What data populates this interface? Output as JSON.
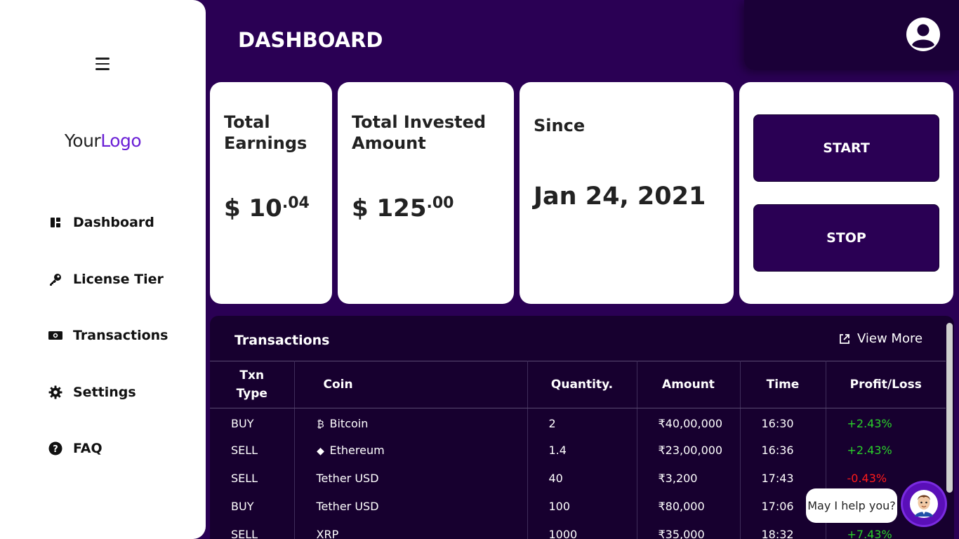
{
  "sidebar": {
    "logo_part1": "Your",
    "logo_part2": "Logo",
    "items": [
      {
        "label": "Dashboard",
        "icon": "dashboard-icon"
      },
      {
        "label": "License Tier",
        "icon": "key-icon"
      },
      {
        "label": "Transactions",
        "icon": "money-icon"
      },
      {
        "label": "Settings",
        "icon": "gear-icon"
      },
      {
        "label": "FAQ",
        "icon": "question-circle-icon"
      }
    ]
  },
  "header": {
    "title": "DASHBOARD",
    "profile_icon": "user-circle-icon"
  },
  "cards": {
    "earnings": {
      "title_line1": "Total",
      "title_line2": "Earnings",
      "currency": "$",
      "whole": "10",
      "decimal": ".04"
    },
    "invested": {
      "title_line1": "Total Invested",
      "title_line2": "Amount",
      "currency": "$",
      "whole": "125",
      "decimal": ".00"
    },
    "since": {
      "title": "Since",
      "date": "Jan 24, 2021"
    },
    "controls": {
      "start_label": "START",
      "stop_label": "STOP"
    }
  },
  "transactions": {
    "title": "Transactions",
    "view_more": "View More",
    "columns": [
      "Txn Type",
      "Coin",
      "Quantity.",
      "Amount",
      "Time",
      "Profit/Loss"
    ],
    "rows": [
      {
        "type": "BUY",
        "coin": "Bitcoin",
        "coin_icon": "₿",
        "quantity": "2",
        "amount": "₹40,00,000",
        "time": "16:30",
        "pl": "+2.43%",
        "pl_color": "#2ad12a"
      },
      {
        "type": "SELL",
        "coin": "Ethereum",
        "coin_icon": "◆",
        "quantity": "1.4",
        "amount": "₹23,00,000",
        "time": "16:36",
        "pl": "+2.43%",
        "pl_color": "#2ad12a"
      },
      {
        "type": "SELL",
        "coin": "Tether USD",
        "coin_icon": "",
        "quantity": "40",
        "amount": "₹3,200",
        "time": "17:43",
        "pl": "-0.43%",
        "pl_color": "#ff1a1a"
      },
      {
        "type": "BUY",
        "coin": "Tether USD",
        "coin_icon": "",
        "quantity": "100",
        "amount": "₹80,000",
        "time": "17:06",
        "pl": "",
        "pl_color": "#2ad12a"
      },
      {
        "type": "SELL",
        "coin": "XRP",
        "coin_icon": "",
        "quantity": "1000",
        "amount": "₹35,000",
        "time": "18:32",
        "pl": "+7.43%",
        "pl_color": "#2ad12a"
      }
    ]
  },
  "chat": {
    "bubble_text": "May I help you?"
  },
  "colors": {
    "background": "#2a0054",
    "panel": "#17002f",
    "accent": "#6a1fd6",
    "profit": "#2ad12a",
    "loss": "#ff1a1a"
  }
}
